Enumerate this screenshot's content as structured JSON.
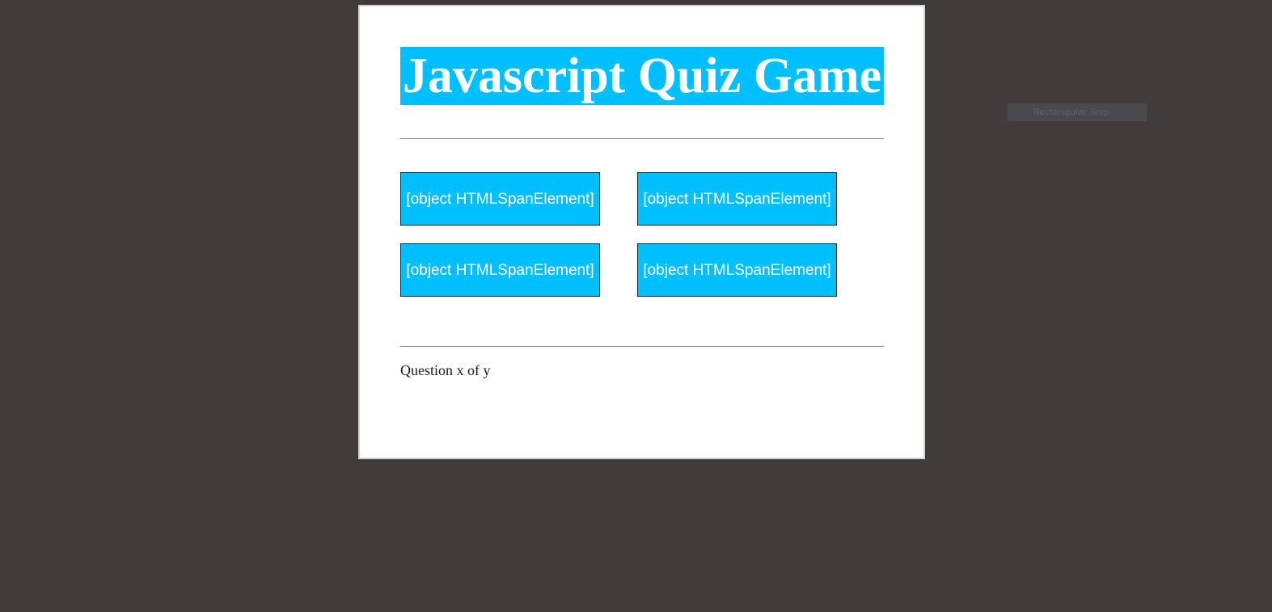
{
  "quiz": {
    "title": "Javascript Quiz Game",
    "answers": [
      {
        "label": "[object HTMLSpanElement]"
      },
      {
        "label": "[object HTMLSpanElement]"
      },
      {
        "label": "[object HTMLSpanElement]"
      },
      {
        "label": "[object HTMLSpanElement]"
      }
    ],
    "progress_text": "Question x of y"
  },
  "overlay": {
    "snip_tooltip": "Rectangular Snip"
  },
  "colors": {
    "background": "#403c3b",
    "accent": "#00bfff",
    "page": "#ffffff"
  }
}
